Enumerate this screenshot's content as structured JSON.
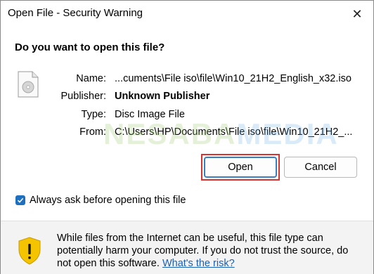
{
  "window": {
    "title": "Open File - Security Warning",
    "close_glyph": "✕"
  },
  "question": "Do you want to open this file?",
  "file": {
    "icon": "disc-image-file-icon",
    "fields": [
      {
        "label": "Name:",
        "value": "...cuments\\File iso\\file\\Win10_21H2_English_x32.iso"
      },
      {
        "label": "Publisher:",
        "value": "Unknown Publisher"
      },
      {
        "label": "Type:",
        "value": "Disc Image File"
      },
      {
        "label": "From:",
        "value": "C:\\Users\\HP\\Documents\\File iso\\file\\Win10_21H2_..."
      }
    ]
  },
  "watermark": {
    "part1": "NESABA",
    "part2": "MEDIA"
  },
  "buttons": {
    "open": "Open",
    "cancel": "Cancel"
  },
  "checkbox": {
    "label": "Always ask before opening this file",
    "checked": true
  },
  "footer": {
    "icon": "shield-warning-icon",
    "text": "While files from the Internet can be useful, this file type can potentially harm your computer. If you do not trust the source, do not open this software.",
    "link": "What's the risk?"
  },
  "colors": {
    "accent": "#1f6fbf",
    "highlight": "#d63333",
    "shield_yellow": "#f5c400"
  }
}
